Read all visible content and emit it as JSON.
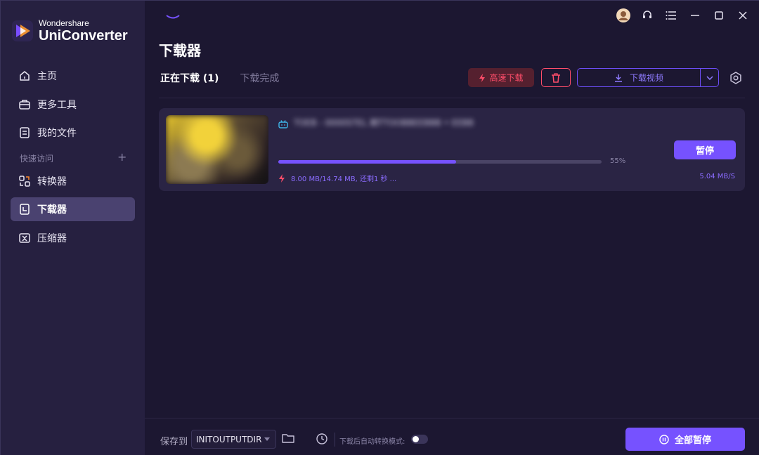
{
  "app": {
    "brand_top": "Wondershare",
    "brand_bottom": "UniConverter"
  },
  "sidebar": {
    "items": [
      {
        "label": "主页",
        "icon": "home-icon"
      },
      {
        "label": "更多工具",
        "icon": "toolbox-icon"
      },
      {
        "label": "我的文件",
        "icon": "file-icon"
      }
    ],
    "section_label": "快速访问",
    "section_add": "+",
    "quick_items": [
      {
        "label": "转换器",
        "icon": "converter-icon"
      },
      {
        "label": "下载器",
        "icon": "downloader-icon",
        "active": true
      },
      {
        "label": "压缩器",
        "icon": "compressor-icon"
      }
    ]
  },
  "header": {
    "title": "下载器",
    "tabs": [
      {
        "label": "正在下载 (1)",
        "active": true
      },
      {
        "label": "下载完成",
        "active": false
      }
    ],
    "fast_download_label": "高速下载",
    "download_video_label": "下载视频"
  },
  "download_item": {
    "title": "TOEB - 0000STEL 期TTOOBBEEBBB • EEBB",
    "progress_percent": 55,
    "progress_text": "55%",
    "info_text": "8.00 MB/14.74 MB, 还剩1 秒 ...",
    "speed_text": "5.04 MB/S",
    "pause_label": "暂停"
  },
  "footer": {
    "save_label": "保存到",
    "save_path": "INITOUTPUTDIR\\",
    "auto_convert_label": "下载后自动转换模式:",
    "auto_convert_on": false,
    "pause_all_label": "全部暂停"
  },
  "colors": {
    "accent": "#7652ff",
    "danger": "#ff4d6a",
    "sidebar_bg": "#262040",
    "main_bg": "#1c1731",
    "card_bg": "#2a2444"
  }
}
